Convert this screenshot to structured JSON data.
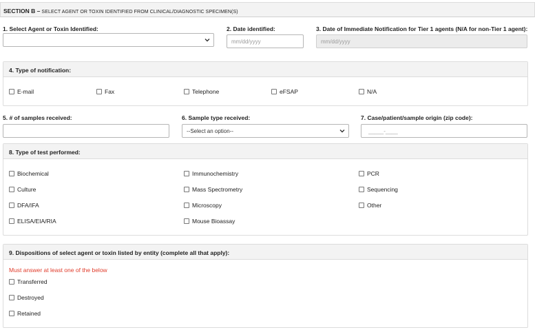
{
  "section": {
    "label": "SECTION B –",
    "subtitle": " SELECT AGENT OR TOXIN IDENTIFIED FROM CLINICAL/DIAGNOSTIC SPECIMEN(S)"
  },
  "q1": {
    "label": "1. Select Agent or Toxin Identified:",
    "value": ""
  },
  "q2": {
    "label": "2. Date identified:",
    "placeholder": "mm/dd/yyyy"
  },
  "q3": {
    "label": "3. Date of Immediate Notification for Tier 1 agents (N/A for non-Tier 1 agent):",
    "placeholder": "mm/dd/yyyy"
  },
  "q4": {
    "label": "4. Type of notification:",
    "options": [
      "E-mail",
      "Fax",
      "Telephone",
      "eFSAP",
      "N/A"
    ]
  },
  "q5": {
    "label": "5. # of samples received:",
    "value": ""
  },
  "q6": {
    "label": "6. Sample type received:",
    "selected": "--Select an option--"
  },
  "q7": {
    "label": "7. Case/patient/sample origin (zip code):",
    "placeholder": "_____-____"
  },
  "q8": {
    "label": "8. Type of test performed:",
    "col1": [
      "Biochemical",
      "Culture",
      "DFA/IFA",
      "ELISA/EIA/RIA"
    ],
    "col2": [
      "Immunochemistry",
      "Mass Spectrometry",
      "Microscopy",
      "Mouse Bioassay"
    ],
    "col3": [
      "PCR",
      "Sequencing",
      "Other"
    ]
  },
  "q9": {
    "label": "9. Dispositions of select agent or toxin listed by entity (complete all that apply):",
    "warning": "Must answer at least one of the below",
    "options": [
      "Transferred",
      "Destroyed",
      "Retained"
    ]
  },
  "colors": {
    "warning": "#e03b2a",
    "panel_header": "#f3f3f3",
    "border": "#dcdcdc"
  }
}
